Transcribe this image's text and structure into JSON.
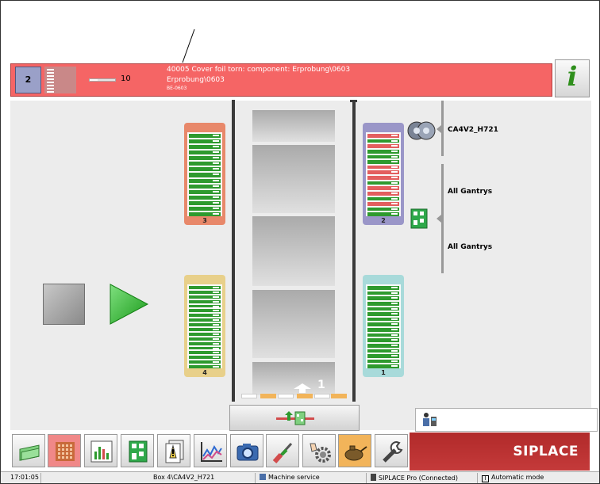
{
  "alarm": {
    "table_number": "2",
    "feeder_count": "10",
    "fill_fraction": 0.3,
    "message_line1": "40005 Cover foil torn: component: Erprobung\\0603",
    "message_line2": "Erprobung\\0603",
    "message_line3": "BE-0603"
  },
  "info_button": {
    "icon": "info-icon",
    "glyph": "i",
    "color": "#2f8f1c"
  },
  "tables": [
    {
      "number": "3",
      "color": "#e8886a",
      "slots": [
        "g",
        "g",
        "g",
        "g",
        "g",
        "g",
        "g",
        "g",
        "g",
        "g",
        "g",
        "g",
        "g",
        "g",
        "g"
      ]
    },
    {
      "number": "2",
      "color": "#9a96c8",
      "slots": [
        "r",
        "g",
        "r",
        "g",
        "g",
        "g",
        "r",
        "r",
        "r",
        "g",
        "r",
        "r",
        "g",
        "r",
        "g",
        "g"
      ]
    },
    {
      "number": "4",
      "color": "#e8d08a",
      "slots": [
        "g",
        "g",
        "g",
        "g",
        "g",
        "g",
        "g",
        "g",
        "g",
        "g",
        "g",
        "g",
        "g",
        "g",
        "g",
        "g",
        "g",
        "g"
      ]
    },
    {
      "number": "1",
      "color": "#a8dada",
      "slots": [
        "g",
        "g",
        "g",
        "g",
        "g",
        "g",
        "g",
        "g",
        "g",
        "g",
        "g",
        "g",
        "g",
        "g",
        "g",
        "g"
      ]
    }
  ],
  "slot_colors": {
    "g": "#2e9a2e",
    "r": "#e35e5e"
  },
  "conveyor": {
    "label": "1"
  },
  "side_labels": {
    "nozzle": "CA4V2_H721",
    "gantry_top": "All Gantrys",
    "gantry_bottom": "All Gantrys"
  },
  "toolbar": {
    "items": [
      "home-icon",
      "feeder-status-icon",
      "statistics-icon",
      "board-icon",
      "documents-icon",
      "trend-chart-icon",
      "camera-icon",
      "screwdriver-icon",
      "settings-gear-icon",
      "oil-can-icon",
      "wrench-icon"
    ],
    "active_index": 0,
    "highlight_index": 1,
    "orange_index": 9,
    "brand": "SIPLACE"
  },
  "status_bar": {
    "time": "17:01:05",
    "line": "Box 4\\CA4V2_H721",
    "mode": "Machine service",
    "connection": "SIPLACE Pro (Connected)",
    "operation": "Automatic mode"
  }
}
